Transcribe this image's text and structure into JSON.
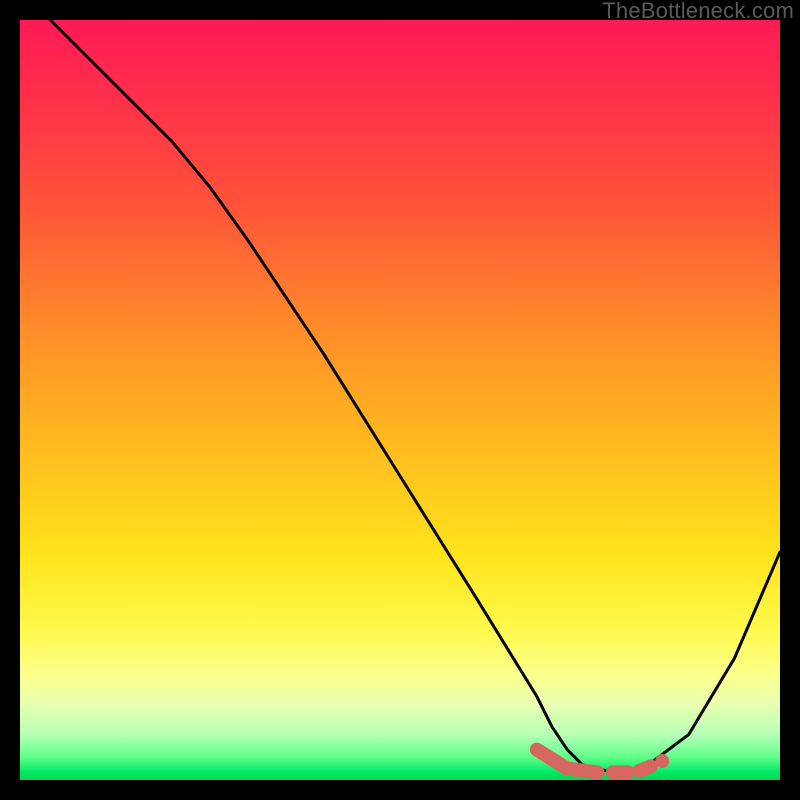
{
  "watermark": "TheBottleneck.com",
  "colors": {
    "background": "#000000",
    "curve": "#000000",
    "segment": "#d6675f",
    "gradient_stops": [
      "#ff1a55",
      "#ff2f4a",
      "#ff5538",
      "#ff8a2a",
      "#ffb81f",
      "#ffe21a",
      "#fff94a",
      "#fcff8a",
      "#e8ffb0",
      "#b6ffb6",
      "#5fff8a",
      "#00e865",
      "#00d94f"
    ]
  },
  "chart_data": {
    "type": "line",
    "title": "",
    "xlabel": "",
    "ylabel": "",
    "xlim": [
      0,
      100
    ],
    "ylim": [
      0,
      100
    ],
    "grid": false,
    "series": [
      {
        "name": "bottleneck-curve",
        "x": [
          4,
          12,
          20,
          25,
          30,
          40,
          50,
          60,
          68,
          70,
          72,
          74,
          76,
          78,
          80,
          82,
          88,
          94,
          100
        ],
        "y": [
          100,
          92,
          84,
          78,
          71,
          56,
          40,
          24,
          11,
          7,
          4,
          2,
          1.5,
          1,
          1,
          1.5,
          6,
          16,
          30
        ]
      }
    ],
    "highlight_segment": {
      "name": "dashed-minimum-segment",
      "color": "#d6675f",
      "parts": [
        {
          "x": [
            68,
            72,
            76
          ],
          "y": [
            4,
            1.5,
            1
          ]
        },
        {
          "x": [
            78,
            80
          ],
          "y": [
            1,
            1
          ]
        },
        {
          "x": [
            81.5,
            83
          ],
          "y": [
            1.2,
            1.8
          ]
        }
      ],
      "dot": {
        "x": 84.5,
        "y": 2.5
      }
    }
  }
}
